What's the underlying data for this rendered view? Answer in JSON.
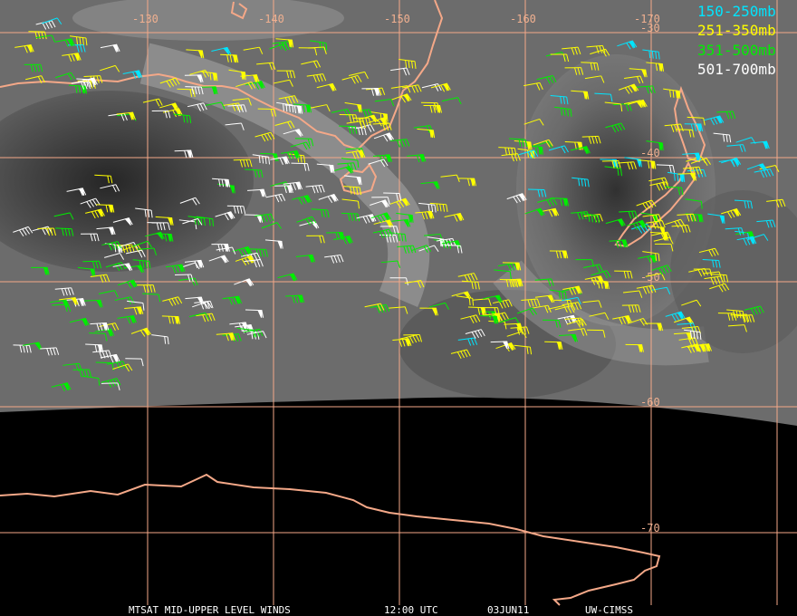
{
  "map": {
    "longitude_labels": [
      "-130",
      "-140",
      "-150",
      "-160",
      "-170"
    ],
    "latitude_labels": [
      "-30",
      "-40",
      "-50",
      "-60",
      "-70"
    ]
  },
  "legend": [
    {
      "label": "150-250mb",
      "color": "#00e5ff"
    },
    {
      "label": "251-350mb",
      "color": "#ffff00"
    },
    {
      "label": "351-500mb",
      "color": "#00ee00"
    },
    {
      "label": "501-700mb",
      "color": "#ffffff"
    }
  ],
  "footer": {
    "product": "MTSAT MID-UPPER LEVEL WINDS",
    "time": "12:00 UTC",
    "date": "03JUN11",
    "source": "UW-CIMSS"
  },
  "colors": {
    "grid": "#f4a888",
    "coastline": "#f4a888",
    "background": "#000000"
  }
}
